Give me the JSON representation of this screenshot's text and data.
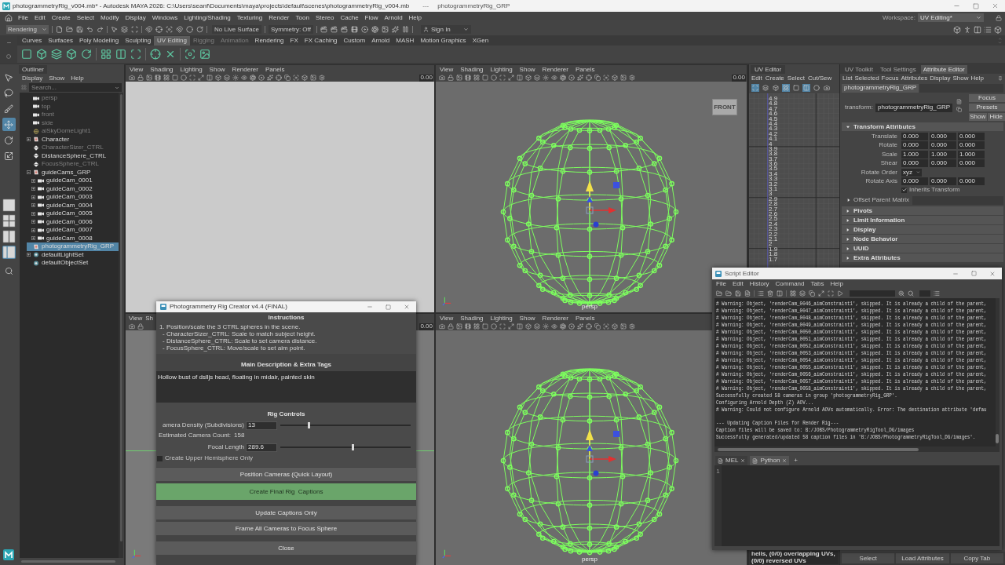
{
  "window": {
    "title": "photogrammetryRig_v004.mb* - Autodesk MAYA 2026: C:\\Users\\seanf\\Documents\\maya\\projects\\default\\scenes\\photogrammetryRig_v004.mb",
    "separator": "---",
    "object": "photogrammetryRig_GRP"
  },
  "menu_bar": [
    "File",
    "Edit",
    "Create",
    "Select",
    "Modify",
    "Display",
    "Windows",
    "Lighting/Shading",
    "Texturing",
    "Render",
    "Toon",
    "Stereo",
    "Cache",
    "Flow",
    "Arnold",
    "Help"
  ],
  "workspace": {
    "label": "Workspace:",
    "value": "UV Editing*"
  },
  "status_line": {
    "menu_set": "Rendering",
    "live_surface": "No Live Surface",
    "symmetry": "Symmetry: Off",
    "sign_in": "Sign In"
  },
  "shelf": {
    "tabs": [
      {
        "label": "Curves",
        "selected": false,
        "disabled": false
      },
      {
        "label": "Surfaces",
        "selected": false,
        "disabled": false
      },
      {
        "label": "Poly Modeling",
        "selected": false,
        "disabled": false
      },
      {
        "label": "Sculpting",
        "selected": false,
        "disabled": false
      },
      {
        "label": "UV Editing",
        "selected": true,
        "disabled": false
      },
      {
        "label": "Rigging",
        "selected": false,
        "disabled": true
      },
      {
        "label": "Animation",
        "selected": false,
        "disabled": true
      },
      {
        "label": "Rendering",
        "selected": false,
        "disabled": false
      },
      {
        "label": "FX",
        "selected": false,
        "disabled": false
      },
      {
        "label": "FX Caching",
        "selected": false,
        "disabled": false
      },
      {
        "label": "Custom",
        "selected": false,
        "disabled": false
      },
      {
        "label": "Arnold",
        "selected": false,
        "disabled": false
      },
      {
        "label": "MASH",
        "selected": false,
        "disabled": false
      },
      {
        "label": "Motion Graphics",
        "selected": false,
        "disabled": false
      },
      {
        "label": "XGen",
        "selected": false,
        "disabled": false
      }
    ]
  },
  "toolbox": {
    "tools": [
      {
        "kind": "select",
        "selected": false
      },
      {
        "kind": "lasso",
        "selected": false
      },
      {
        "kind": "paint",
        "selected": false
      },
      {
        "kind": "move",
        "selected": true
      },
      {
        "kind": "rotate",
        "selected": false
      },
      {
        "kind": "scale",
        "selected": false
      }
    ],
    "layouts": [
      {
        "kind": "single",
        "selected": false
      },
      {
        "kind": "quad",
        "selected": false
      },
      {
        "kind": "split",
        "selected": false
      },
      {
        "kind": "outliner",
        "selected": true
      }
    ]
  },
  "outliner": {
    "title": "Outliner",
    "menu": [
      "Display",
      "Show",
      "Help"
    ],
    "search": {
      "placeholder": "Search..."
    },
    "items": [
      {
        "label": "persp",
        "kind": "camera",
        "dimmed": true,
        "selected": false
      },
      {
        "label": "top",
        "kind": "camera",
        "dimmed": true,
        "selected": false
      },
      {
        "label": "front",
        "kind": "camera",
        "dimmed": true,
        "selected": false
      },
      {
        "label": "side",
        "kind": "camera",
        "dimmed": true,
        "selected": false
      },
      {
        "label": "aiSkyDomeLight1",
        "kind": "light",
        "dimmed": true,
        "selected": false
      },
      {
        "label": "Character",
        "kind": "group",
        "dimmed": false,
        "selected": false,
        "expanded": false
      },
      {
        "label": "CharacterSizer_CTRL",
        "kind": "locator",
        "dimmed": true,
        "selected": false
      },
      {
        "label": "DistanceSphere_CTRL",
        "kind": "locator",
        "dimmed": false,
        "selected": false
      },
      {
        "label": "FocusSphere_CTRL",
        "kind": "locator",
        "dimmed": true,
        "selected": false
      },
      {
        "label": "guideCams_GRP",
        "kind": "group",
        "dimmed": false,
        "selected": false,
        "expanded": true,
        "children": [
          {
            "label": "guideCam_0001",
            "kind": "camera",
            "dimmed": false,
            "selected": false,
            "expanded": false
          },
          {
            "label": "guideCam_0002",
            "kind": "camera",
            "dimmed": false,
            "selected": false,
            "expanded": false
          },
          {
            "label": "guideCam_0003",
            "kind": "camera",
            "dimmed": false,
            "selected": false,
            "expanded": false
          },
          {
            "label": "guideCam_0004",
            "kind": "camera",
            "dimmed": false,
            "selected": false,
            "expanded": false
          },
          {
            "label": "guideCam_0005",
            "kind": "camera",
            "dimmed": false,
            "selected": false,
            "expanded": false
          },
          {
            "label": "guideCam_0006",
            "kind": "camera",
            "dimmed": false,
            "selected": false,
            "expanded": false
          },
          {
            "label": "guideCam_0007",
            "kind": "camera",
            "dimmed": false,
            "selected": false,
            "expanded": false
          },
          {
            "label": "guideCam_0008",
            "kind": "camera",
            "dimmed": false,
            "selected": false,
            "expanded": false
          }
        ]
      },
      {
        "label": "photogrammetryRig_GRP",
        "kind": "group",
        "dimmed": false,
        "selected": true
      },
      {
        "label": "defaultLightSet",
        "kind": "set",
        "dimmed": false,
        "selected": false,
        "expanded": false
      },
      {
        "label": "defaultObjectSet",
        "kind": "set",
        "dimmed": false,
        "selected": false
      }
    ]
  },
  "viewports": [
    {
      "kind": "empty",
      "menu": [
        "View",
        "Shading",
        "Lighting",
        "Show",
        "Renderer",
        "Panels"
      ],
      "exposure": "0.00"
    },
    {
      "kind": "sphere",
      "menu": [
        "View",
        "Shading",
        "Lighting",
        "Show",
        "Renderer",
        "Panels"
      ],
      "exposure": "0.00",
      "view_cube": "FRONT",
      "camera": "persp"
    },
    {
      "kind": "ground",
      "menu": [
        "View",
        "Sh"
      ],
      "exposure": "0.00"
    },
    {
      "kind": "sphere",
      "menu": [
        "View",
        "Shading",
        "Lighting",
        "Show",
        "Renderer",
        "Panels"
      ],
      "camera": "persp"
    }
  ],
  "uv_editor": {
    "title": "UV Editor",
    "menu": [
      "Edit",
      "Create",
      "Select",
      "Cut/Sew"
    ],
    "toolbar": [
      {
        "kind": "uv-select",
        "selected": true
      },
      {
        "kind": "shell",
        "selected": false
      },
      {
        "kind": "shell-border",
        "selected": false
      },
      {
        "kind": "grid",
        "selected": true
      },
      {
        "kind": "frame",
        "selected": false
      },
      {
        "kind": "checker",
        "selected": true
      },
      {
        "kind": "circle",
        "selected": false
      },
      {
        "kind": "camera",
        "selected": false
      }
    ],
    "ticks": [
      "4.9",
      "4.8",
      "4.7",
      "4.6",
      "4.5",
      "4.4",
      "4.3",
      "4.2",
      "4.1",
      "4",
      "3.9",
      "3.8",
      "3.7",
      "3.6",
      "3.5",
      "3.4",
      "3.3",
      "3.2",
      "3.1",
      "3",
      "2.9",
      "2.8",
      "2.7",
      "2.6",
      "2.5",
      "2.4",
      "2.3",
      "2.2",
      "2.1",
      "2",
      "1.9",
      "1.8",
      "1.7"
    ],
    "status": "hells, (0/0) overlapping UVs, (0/0) reversed UVs"
  },
  "attribute_editor": {
    "tabs": [
      {
        "label": "UV Toolkit",
        "selected": false
      },
      {
        "label": "Tool Settings",
        "selected": false
      },
      {
        "label": "Attribute Editor",
        "selected": true
      }
    ],
    "menu": [
      "List",
      "Selected",
      "Focus",
      "Attributes",
      "Display",
      "Show",
      "Help"
    ],
    "node_tab": "photogrammetryRig_GRP",
    "node_type": "transform:",
    "node_name": "photogrammetryRig_GRP",
    "buttons": [
      "Focus",
      "Presets",
      "Show",
      "Hide"
    ],
    "sections": [
      {
        "title": "Transform Attributes",
        "expanded": true,
        "rows": [
          {
            "kind": "vector",
            "label": "Translate",
            "values": [
              "0.000",
              "0.000",
              "0.000"
            ]
          },
          {
            "kind": "vector",
            "label": "Rotate",
            "values": [
              "0.000",
              "0.000",
              "0.000"
            ]
          },
          {
            "kind": "vector",
            "label": "Scale",
            "values": [
              "1.000",
              "1.000",
              "1.000"
            ]
          },
          {
            "kind": "vector",
            "label": "Shear",
            "values": [
              "0.000",
              "0.000",
              "0.000"
            ]
          },
          {
            "kind": "dropdown",
            "label": "Rotate Order",
            "value": "xyz"
          },
          {
            "kind": "vector",
            "label": "Rotate Axis",
            "values": [
              "0.000",
              "0.000",
              "0.000"
            ]
          },
          {
            "kind": "checkbox",
            "label": "Inherits Transform",
            "checked": true
          },
          {
            "kind": "subsection",
            "label": "Offset Parent Matrix",
            "expanded": false
          }
        ]
      },
      {
        "title": "Pivots",
        "expanded": false
      },
      {
        "title": "Limit Information",
        "expanded": false
      },
      {
        "title": "Display",
        "expanded": false
      },
      {
        "title": "Node Behavior",
        "expanded": false
      },
      {
        "title": "UUID",
        "expanded": false
      },
      {
        "title": "Extra Attributes",
        "expanded": false
      }
    ],
    "footer_buttons": [
      "Select",
      "Load Attributes",
      "Copy Tab"
    ]
  },
  "rig_creator": {
    "title": "Photogrammetry Rig Creator v4.4 (FINAL)",
    "instructions": {
      "heading": "Instructions",
      "lines": [
        {
          "text": "1. Position/scale the 3 CTRL spheres in the scene.",
          "children": [
            "- CharacterSizer_CTRL: Scale to match subject height.",
            "- DistanceSphere_CTRL: Scale to set camera distance.",
            "- FocusSphere_CTRL: Move/scale to set aim point."
          ]
        }
      ]
    },
    "description": {
      "heading": "Main Description & Extra Tags",
      "value": "Hollow bust of dslljs head, floating in midair, painted skin"
    },
    "controls": {
      "heading": "Rig Controls",
      "rows": [
        {
          "kind": "slider",
          "label": "amera Density (Subdivisions)",
          "value": "13",
          "level": 0.22
        },
        {
          "kind": "readout",
          "label": "Estimated Camera Count:",
          "value": "158"
        },
        {
          "kind": "slider",
          "label": "Focal Length",
          "value": "289.6",
          "level": 0.56
        },
        {
          "kind": "checkbox",
          "label": "Create Upper Hemisphere Only",
          "checked": false
        }
      ]
    },
    "buttons": [
      {
        "label": "Position Cameras (Quick Layout)",
        "kind": "default"
      },
      {
        "label": "Create Final Rig  Captions",
        "kind": "primary"
      },
      {
        "label": "Update Captions Only",
        "kind": "default"
      },
      {
        "label": "Frame All Cameras to Focus Sphere",
        "kind": "default"
      },
      {
        "label": "Close",
        "kind": "default"
      }
    ]
  },
  "script_editor": {
    "title": "Script Editor",
    "menu": [
      "File",
      "Edit",
      "History",
      "Command",
      "Tabs",
      "Help"
    ],
    "output": [
      [
        "# Warning: Object, 'renderCam_0046_aimConstraint1', skipped. It is already a child of the parent,",
        "# Warning: Object, 'renderCam_0047_aimConstraint1', skipped. It is already a child of the parent,",
        "# Warning: Object, 'renderCam_0048_aimConstraint1', skipped. It is already a child of the parent,",
        "# Warning: Object, 'renderCam_0049_aimConstraint1', skipped. It is already a child of the parent,",
        "# Warning: Object, 'renderCam_0050_aimConstraint1', skipped. It is already a child of the parent,",
        "# Warning: Object, 'renderCam_0051_aimConstraint1', skipped. It is already a child of the parent,",
        "# Warning: Object, 'renderCam_0052_aimConstraint1', skipped. It is already a child of the parent,",
        "# Warning: Object, 'renderCam_0053_aimConstraint1', skipped. It is already a child of the parent,",
        "# Warning: Object, 'renderCam_0054_aimConstraint1', skipped. It is already a child of the parent,",
        "# Warning: Object, 'renderCam_0055_aimConstraint1', skipped. It is already a child of the parent,",
        "# Warning: Object, 'renderCam_0056_aimConstraint1', skipped. It is already a child of the parent,",
        "# Warning: Object, 'renderCam_0057_aimConstraint1', skipped. It is already a child of the parent,",
        "# Warning: Object, 'renderCam_0058_aimConstraint1', skipped. It is already a child of the parent,",
        "Successfully created 58 cameras in group 'photogrammetryRig_GRP'.",
        "Configuring Arnold Depth (Z) AOV...",
        "# Warning: Could not configure Arnold AOVs automatically. Error: The destination attribute 'defau"
      ],
      [
        "--- Updating Caption Files for Render Rig---",
        "Caption files will be saved to: B:/JOBS/PhotogrammetryRigTool_DG/images",
        "Successfully generated/updated 58 caption files in 'B:/JOBS/PhotogrammetryRigTool_DG/images'."
      ]
    ],
    "tabs": [
      {
        "label": "MEL",
        "selected": false
      },
      {
        "label": "Python",
        "selected": true
      }
    ],
    "add_tab": "+",
    "line_numbers": [
      "1"
    ]
  }
}
